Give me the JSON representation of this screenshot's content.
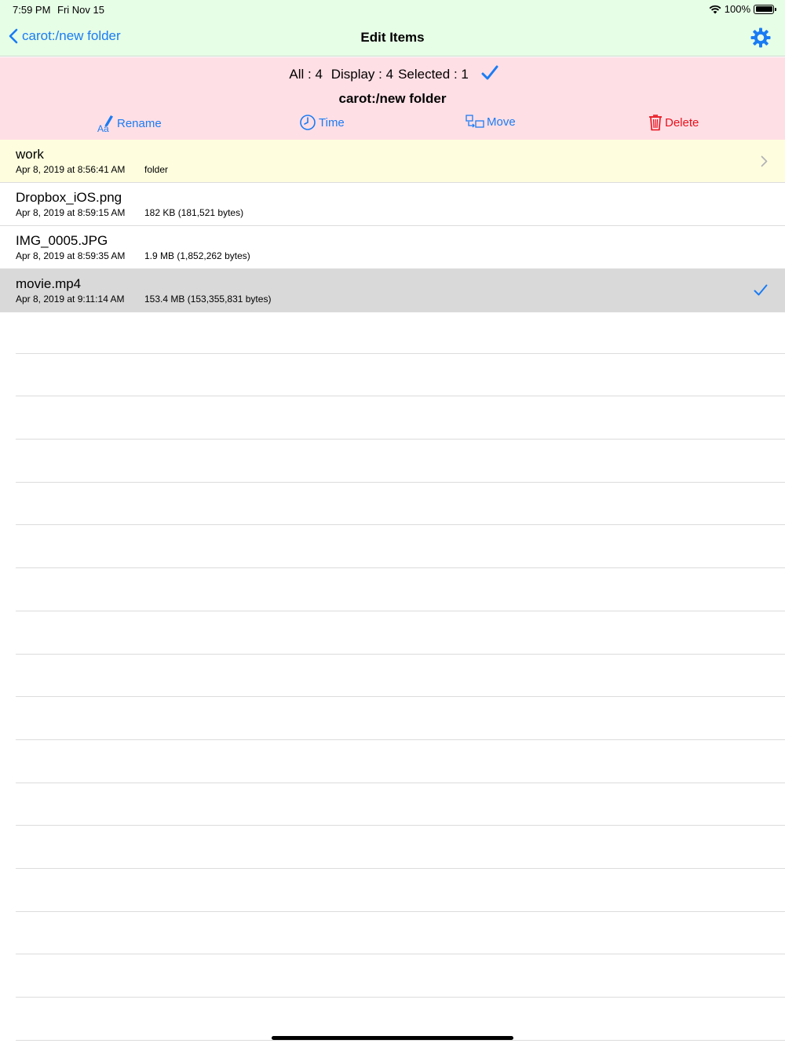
{
  "status_bar": {
    "time": "7:59 PM",
    "date": "Fri Nov 15",
    "battery": "100%"
  },
  "nav": {
    "back_label": "carot:/new folder",
    "title": "Edit Items"
  },
  "info": {
    "all": "All : 4",
    "display": "Display : 4",
    "selected": "Selected : 1",
    "path": "carot:/new folder"
  },
  "actions": {
    "rename": "Rename",
    "time": "Time",
    "move": "Move",
    "delete": "Delete"
  },
  "items": [
    {
      "name": "work",
      "date": "Apr 8, 2019 at 8:56:41 AM",
      "meta": "folder"
    },
    {
      "name": "Dropbox_iOS.png",
      "date": "Apr 8, 2019 at 8:59:15 AM",
      "meta": "182 KB (181,521 bytes)"
    },
    {
      "name": "IMG_0005.JPG",
      "date": "Apr 8, 2019 at 8:59:35 AM",
      "meta": "1.9 MB (1,852,262 bytes)"
    },
    {
      "name": "movie.mp4",
      "date": "Apr 8, 2019 at 9:11:14 AM",
      "meta": "153.4 MB (153,355,831 bytes)"
    }
  ],
  "colors": {
    "accent": "#1a7cf4",
    "delete": "#e8101a",
    "header_bg": "#e6fde6",
    "info_bg": "#ffdfe6",
    "folder_row_bg": "#fefedf",
    "selected_row_bg": "#d9d9d9"
  }
}
